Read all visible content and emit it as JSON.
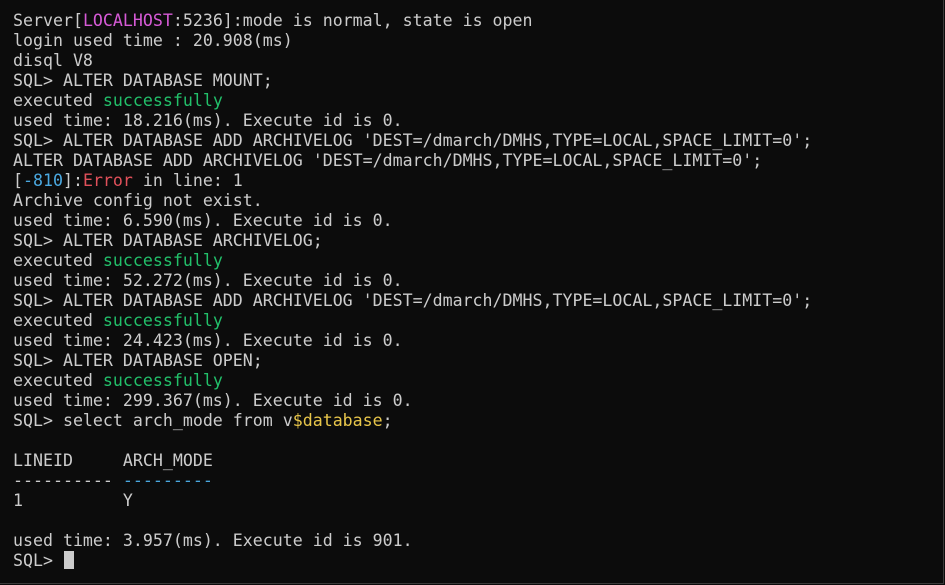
{
  "colors": {
    "background": "#0c0c0c",
    "text": "#cccccc",
    "host": "#d65ad6",
    "success": "#22c06a",
    "error": "#e0505a",
    "error_code": "#4aa8e0",
    "dollar": "#e8c64a",
    "cursor": "#cccccc"
  },
  "terminal": {
    "lines": [
      [
        {
          "text": "Server[",
          "color": "default"
        },
        {
          "text": "LOCALHOST",
          "color": "magenta"
        },
        {
          "text": ":5236]:mode is normal, state is open",
          "color": "default"
        }
      ],
      [
        {
          "text": "login used time : 20.908(ms)",
          "color": "default"
        }
      ],
      [
        {
          "text": "disql V8",
          "color": "default"
        }
      ],
      [
        {
          "text": "SQL> ALTER DATABASE MOUNT;",
          "color": "default"
        }
      ],
      [
        {
          "text": "executed ",
          "color": "default"
        },
        {
          "text": "successfully",
          "color": "green"
        }
      ],
      [
        {
          "text": "used time: 18.216(ms). Execute id is 0.",
          "color": "default"
        }
      ],
      [
        {
          "text": "SQL> ALTER DATABASE ADD ARCHIVELOG 'DEST=/dmarch/DMHS,TYPE=LOCAL,SPACE_LIMIT=0';",
          "color": "default"
        }
      ],
      [
        {
          "text": "ALTER DATABASE ADD ARCHIVELOG 'DEST=/dmarch/DMHS,TYPE=LOCAL,SPACE_LIMIT=0';",
          "color": "default"
        }
      ],
      [
        {
          "text": "[",
          "color": "default"
        },
        {
          "text": "-810",
          "color": "cyan"
        },
        {
          "text": "]:",
          "color": "default"
        },
        {
          "text": "Error",
          "color": "red"
        },
        {
          "text": " in line: 1",
          "color": "default"
        }
      ],
      [
        {
          "text": "Archive config not exist.",
          "color": "default"
        }
      ],
      [
        {
          "text": "used time: 6.590(ms). Execute id is 0.",
          "color": "default"
        }
      ],
      [
        {
          "text": "SQL> ALTER DATABASE ARCHIVELOG;",
          "color": "default"
        }
      ],
      [
        {
          "text": "executed ",
          "color": "default"
        },
        {
          "text": "successfully",
          "color": "green"
        }
      ],
      [
        {
          "text": "used time: 52.272(ms). Execute id is 0.",
          "color": "default"
        }
      ],
      [
        {
          "text": "SQL> ALTER DATABASE ADD ARCHIVELOG 'DEST=/dmarch/DMHS,TYPE=LOCAL,SPACE_LIMIT=0';",
          "color": "default"
        }
      ],
      [
        {
          "text": "executed ",
          "color": "default"
        },
        {
          "text": "successfully",
          "color": "green"
        }
      ],
      [
        {
          "text": "used time: 24.423(ms). Execute id is 0.",
          "color": "default"
        }
      ],
      [
        {
          "text": "SQL> ALTER DATABASE OPEN;",
          "color": "default"
        }
      ],
      [
        {
          "text": "executed ",
          "color": "default"
        },
        {
          "text": "successfully",
          "color": "green"
        }
      ],
      [
        {
          "text": "used time: 299.367(ms). Execute id is 0.",
          "color": "default"
        }
      ],
      [
        {
          "text": "SQL> select arch_mode from v",
          "color": "default"
        },
        {
          "text": "$database",
          "color": "yellow"
        },
        {
          "text": ";",
          "color": "default"
        }
      ],
      [],
      [
        {
          "text": "LINEID     ARCH_MODE",
          "color": "default"
        }
      ],
      [
        {
          "text": "---------- ",
          "color": "default"
        },
        {
          "text": "---------",
          "color": "cyan"
        }
      ],
      [
        {
          "text": "1          Y",
          "color": "default"
        }
      ],
      [],
      [
        {
          "text": "used time: 3.957(ms). Execute id is 901.",
          "color": "default"
        }
      ],
      [
        {
          "text": "SQL> ",
          "color": "default"
        }
      ]
    ],
    "cursor_icon": "block-cursor"
  }
}
